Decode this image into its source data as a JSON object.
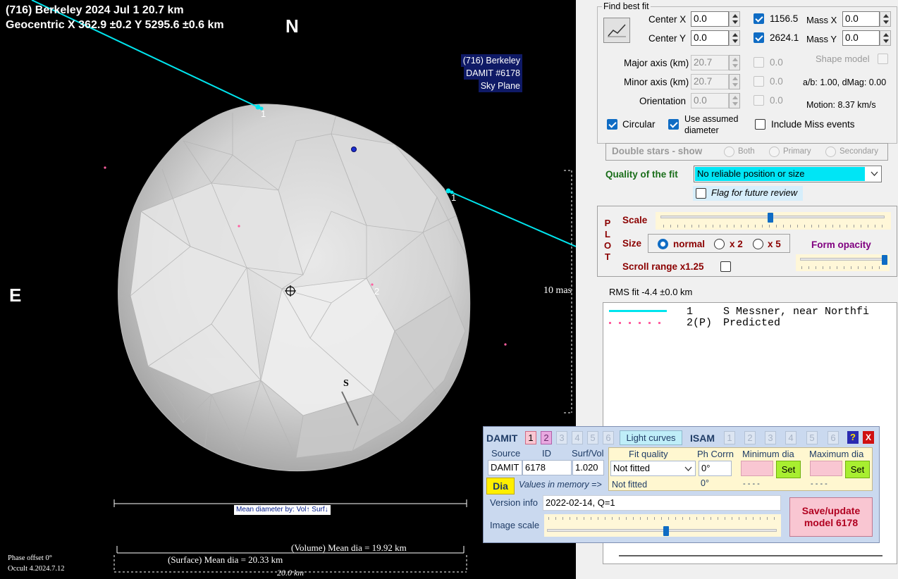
{
  "plot": {
    "title_line1": "(716) Berkeley  2024 Jul 1  20.7 km",
    "title_line2": "Geocentric  X  362.9 ±0.2  Y 5295.6 ±0.6 km",
    "north": "N",
    "east": "E",
    "info_box": [
      "(716) Berkeley",
      "DAMIT #6178",
      "Sky Plane"
    ],
    "chord_labels": [
      "1",
      "1",
      "2"
    ],
    "s_marker": "S",
    "scale_label": "10 mas",
    "mean_diameter_label": "Mean diameter by: Vol↑ Surf↓",
    "volume_mean_dia": "(Volume) Mean dia = 19.92 km",
    "surface_mean_dia": "(Surface) Mean dia = 20.33 km",
    "scale_bar": "20.0 km",
    "phase_offset": "Phase offset 0°",
    "version": "Occult 4.2024.7.12",
    "colors": {
      "chord": "#00e5ee",
      "predicted": "#ff5fa0",
      "shape": "#d4d4d4"
    }
  },
  "fit": {
    "group_title": "Find best fit",
    "center_x_label": "Center X",
    "center_x_value": "0.0",
    "center_y_label": "Center Y",
    "center_y_value": "0.0",
    "major_label": "Major axis (km)",
    "major_value": "20.7",
    "minor_label": "Minor axis (km)",
    "minor_value": "20.7",
    "orientation_label": "Orientation",
    "orientation_value": "0.0",
    "cx_fit_value": "1156.5",
    "cy_fit_value": "2624.1",
    "major_fit_value": "0.0",
    "minor_fit_value": "0.0",
    "orient_fit_value": "0.0",
    "mass_x_label": "Mass X",
    "mass_x_value": "0.0",
    "mass_y_label": "Mass Y",
    "mass_y_value": "0.0",
    "shape_model_label": "Shape model",
    "ab_text": "a/b: 1.00, dMag: 0.00",
    "motion_text": "Motion: 8.37 km/s",
    "circular_label": "Circular",
    "use_assumed_line1": "Use assumed",
    "use_assumed_line2": "diameter",
    "include_miss_label": "Include Miss events"
  },
  "double_stars": {
    "label": "Double stars - show",
    "both": "Both",
    "primary": "Primary",
    "secondary": "Secondary"
  },
  "quality": {
    "label": "Quality of the fit",
    "value": "No reliable position or size",
    "flag_label": "Flag for future review"
  },
  "plot_controls": {
    "plot_letters": [
      "P",
      "L",
      "O",
      "T"
    ],
    "scale_label": "Scale",
    "scale_value": 0.49,
    "size_label": "Size",
    "normal_label": "normal",
    "x2_label": "x 2",
    "x5_label": "x 5",
    "form_opacity_label": "Form opacity",
    "opacity_value": 1.0,
    "scroll_range_label": "Scroll range x1.25"
  },
  "rms": "RMS fit -4.4 ±0.0 km",
  "legend": [
    {
      "num": "1",
      "text": "S Messner, near Northfi"
    },
    {
      "num": "2(P)",
      "text": "Predicted"
    }
  ],
  "damit": {
    "title": "DAMIT",
    "nums": [
      "1",
      "2",
      "3",
      "4",
      "5",
      "6"
    ],
    "light_curves": "Light curves",
    "isam": "ISAM",
    "isam_nums": [
      "1",
      "2",
      "3",
      "4",
      "5",
      "6"
    ],
    "help": "?",
    "close": "X",
    "source_label": "Source",
    "id_label": "ID",
    "surfvol_label": "Surf/Vol",
    "source_value": "DAMIT",
    "id_value": "6178",
    "surfvol_value": "1.020",
    "fit_quality_label": "Fit quality",
    "ph_corrn_label": "Ph Corrn",
    "min_dia_label": "Minimum dia",
    "max_dia_label": "Maximum dia",
    "fit_quality_value": "Not fitted",
    "ph_value": "0°",
    "set_label": "Set",
    "dia_button": "Dia",
    "values_in_memory": "Values in memory =>",
    "mem_fit_quality": "Not fitted",
    "mem_ph": "0°",
    "mem_min": "- - - -",
    "mem_max": "- - - -",
    "version_label": "Version info",
    "version_value": "2022-02-14, Q=1",
    "image_scale_label": "Image scale",
    "image_scale_value": 0.52,
    "save_line1": "Save/update",
    "save_line2": "model 6178"
  }
}
